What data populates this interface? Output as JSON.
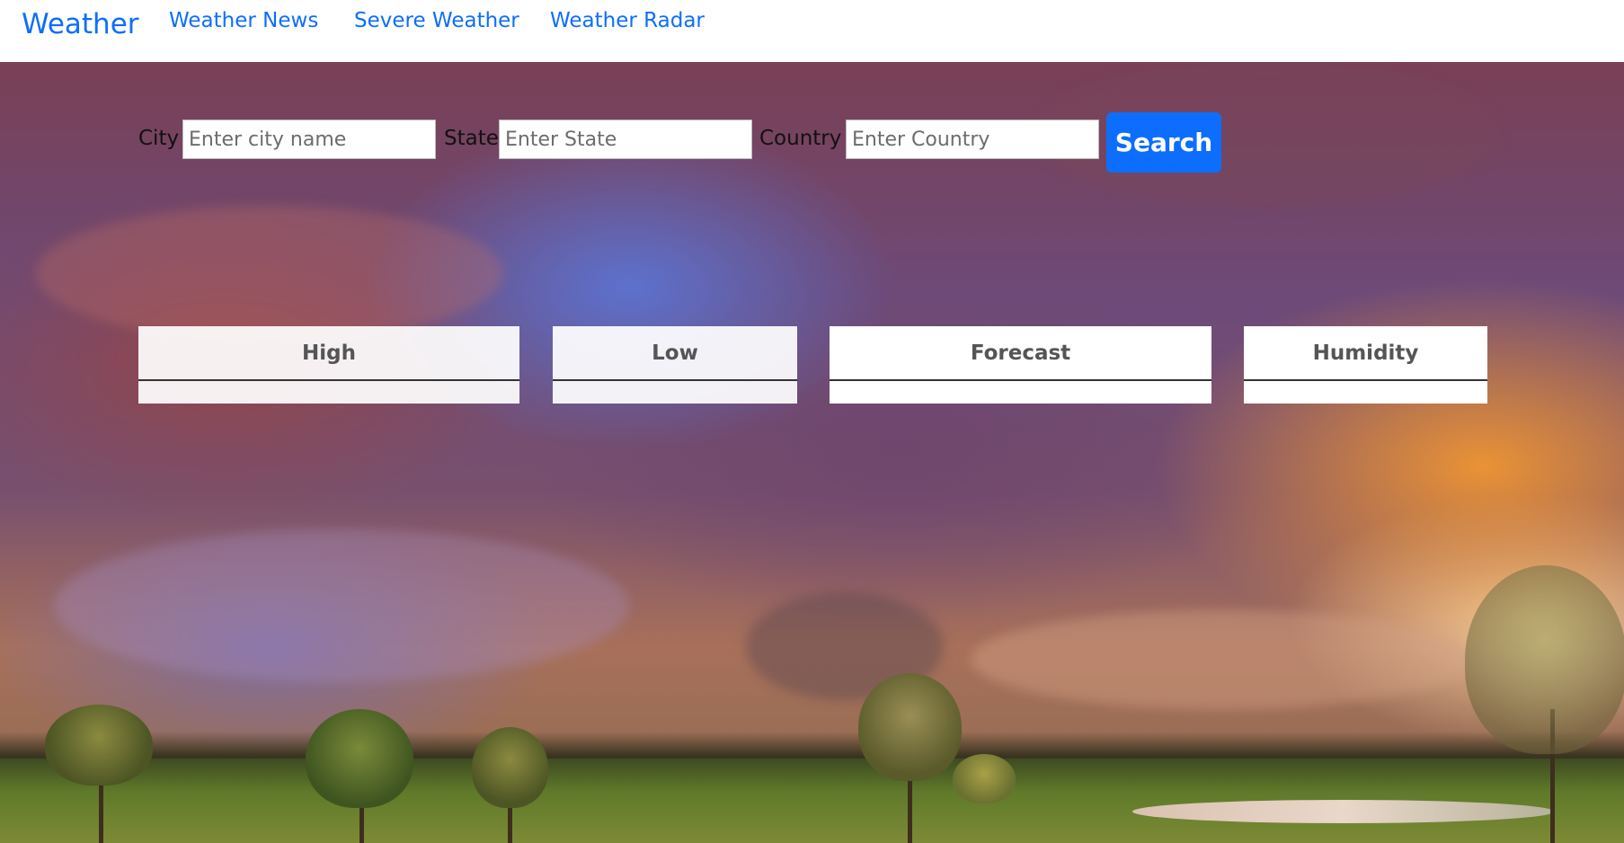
{
  "nav": {
    "brand": "Weather",
    "links": [
      {
        "label": "Weather News"
      },
      {
        "label": "Severe Weather"
      },
      {
        "label": "Weather Radar"
      }
    ]
  },
  "search": {
    "city_label": "City",
    "city_placeholder": "Enter city name",
    "state_label": "State",
    "state_placeholder": "Enter State",
    "country_label": "Country",
    "country_placeholder": "Enter Country",
    "button_label": "Search"
  },
  "cards": [
    {
      "title": "High",
      "value": ""
    },
    {
      "title": "Low",
      "value": ""
    },
    {
      "title": "Forecast",
      "value": ""
    },
    {
      "title": "Humidity",
      "value": ""
    }
  ],
  "colors": {
    "accent": "#0d6efd"
  }
}
